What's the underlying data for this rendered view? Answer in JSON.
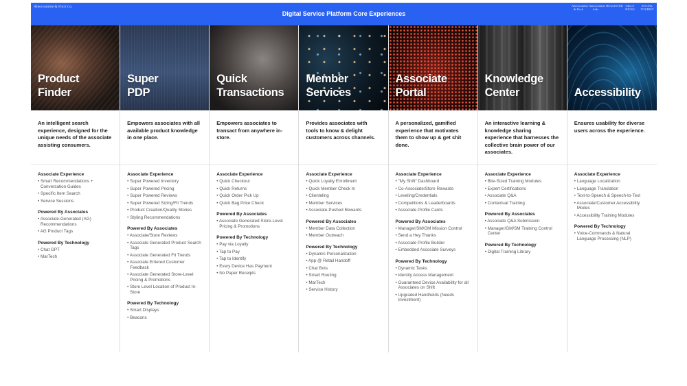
{
  "header": {
    "brand": "Abercrombie & Fitch Co.",
    "title": "Digital Service Platform Core Experiences",
    "partner_logos": [
      "Abercrombie & Fitch",
      "Abercrombie kids",
      "HOLLISTER",
      "GILLY HICKS",
      "SOCIAL TOURIST"
    ]
  },
  "columns": [
    {
      "title": "Product\nFinder",
      "description": "An intelligent search experience, designed for the unique needs of the associate assisting consumers.",
      "sections": [
        {
          "title": "Associate Experience",
          "items": [
            "Smart Recommendations + Conversation Guides",
            "Specific Item Search",
            "Service Sessions"
          ]
        },
        {
          "title": "Powered By Associates",
          "items": [
            "Associate-Generated (AG) Recommendations",
            "AG Product Tags"
          ]
        },
        {
          "title": "Powered By Technology",
          "items": [
            "Chat GPT",
            "MarTech"
          ]
        }
      ]
    },
    {
      "title": "Super\nPDP",
      "description": "Empowers associates with all available product knowledge in one place.",
      "sections": [
        {
          "title": "Associate Experience",
          "items": [
            "Super Powered Inventory",
            "Super Powered Pricing",
            "Super Powered Reviews",
            "Super Powered Sizing/Fit Trends",
            "Product Creation/Quality Stories",
            "Styling Recommendations"
          ]
        },
        {
          "title": "Powered By Associates",
          "items": [
            "Associate/Store Reviews",
            "Associate Generated Product Search Tags",
            "Associate Generated Fit Trends",
            "Associate Entered Customer Feedback",
            "Associate Generated Store-Level Pricing & Promotions",
            "Store Level Location of Product In-Store"
          ]
        },
        {
          "title": "Powered By Technology",
          "items": [
            "Smart Displays",
            "Beacons"
          ]
        }
      ]
    },
    {
      "title": "Quick\nTransactions",
      "description": "Empowers associates to transact from anywhere in-store.",
      "sections": [
        {
          "title": "Associate Experience",
          "items": [
            "Quick Checkout",
            "Quick Returns",
            "Quick Order Pick Up",
            "Quick Bag Price Check"
          ]
        },
        {
          "title": "Powered By Associates",
          "items": [
            "Associate Generated Store-Level Pricing & Promotions"
          ]
        },
        {
          "title": "Powered By Technology",
          "items": [
            "Pay via Loyalty",
            "Tap to Pay",
            "Tap to Identify",
            "Every Device Has Payment",
            "No Paper Receipts"
          ]
        }
      ]
    },
    {
      "title": "Member\nServices",
      "description": "Provides associates with tools to know & delight customers across channels.",
      "sections": [
        {
          "title": "Associate Experience",
          "items": [
            "Quick Loyalty Enrollment",
            "Quick Member Check In",
            "Clienteling",
            "Member Services",
            "Associate-Pushed Rewards"
          ]
        },
        {
          "title": "Powered By Associates",
          "items": [
            "Member Data Collection",
            "Member Outreach"
          ]
        },
        {
          "title": "Powered By Technology",
          "items": [
            "Dynamic Personalization",
            "App @ Retail Handoff",
            "Chat Bots",
            "Smart Routing",
            "MarTech",
            "Service History"
          ]
        }
      ]
    },
    {
      "title": "Associate\nPortal",
      "description": "A personalized, gamified experience that motivates them to show up & get shit done.",
      "sections": [
        {
          "title": "Associate Experience",
          "items": [
            "\"My Shift\" Dashboard",
            "Co-Associate/Store Rewards",
            "Leveling/Credentials",
            "Competitions & Leaderboards",
            "Associate Profile Cards"
          ]
        },
        {
          "title": "Powered By Associates",
          "items": [
            "Manager/SM/GM Mission Control",
            "Send a Hey Thanks",
            "Associate Profile Builder",
            "Embedded Associate Surveys"
          ]
        },
        {
          "title": "Powered By Technology",
          "items": [
            "Dynamic Tasks",
            "Identity Access Management",
            "Guaranteed Device Availability for all Associates on Shift",
            "Upgraded Handhelds (Needs Investment)"
          ]
        }
      ]
    },
    {
      "title": "Knowledge\nCenter",
      "description": "An interactive learning & knowledge sharing experience that harnesses the collective brain power of our associates.",
      "sections": [
        {
          "title": "Associate Experience",
          "items": [
            "Bite-Sized Training Modules",
            "Expert Certifications",
            "Associate Q&A",
            "Contextual Training"
          ]
        },
        {
          "title": "Powered By Associates",
          "items": [
            "Associate Q&A Submission",
            "Manager/GM/SM Training Control Center"
          ]
        },
        {
          "title": "Powered By Technology",
          "items": [
            "Digital Training Library"
          ]
        }
      ]
    },
    {
      "title": "Accessibility",
      "description": "Ensures usability for diverse users across the experience.",
      "sections": [
        {
          "title": "Associate Experience",
          "items": [
            "Language Localization",
            "Language Translation",
            "Text-to-Speech & Speech-to-Text",
            "Associate/Customer Accessibility Modes",
            "Accessibility Training Modules"
          ]
        },
        {
          "title": "Powered By Technology",
          "items": [
            "Voice-Commands & Natural Language Processing (NLP)"
          ]
        }
      ]
    }
  ]
}
